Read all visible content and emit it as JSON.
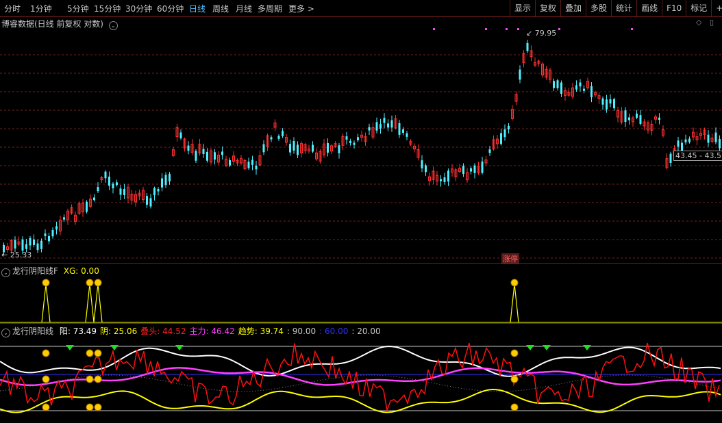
{
  "toolbar": {
    "periods": [
      "分时",
      "1分钟",
      "5分钟",
      "15分钟",
      "30分钟",
      "60分钟",
      "日线",
      "周线",
      "月线",
      "多周期",
      "更多 >"
    ],
    "active_period": "日线",
    "right_buttons": [
      "显示",
      "复权",
      "叠加",
      "多股",
      "统计",
      "画线",
      "F10",
      "标记",
      "+自选"
    ]
  },
  "main_chart": {
    "title": "博睿数据(日线 前复权 对数)",
    "high_label": "79.95",
    "low_label": "25.33",
    "last_price_label": "43.45 - 43.5",
    "event_badge": "涨停"
  },
  "indicator1": {
    "title": "龙行阴阳线F",
    "xg_label": "XG: 0.00"
  },
  "indicator2": {
    "title": "龙行阴阳线",
    "values": [
      {
        "name": "阳",
        "value": "73.49",
        "color": "#ffffff"
      },
      {
        "name": "阴",
        "value": "25.06",
        "color": "#ffff00"
      },
      {
        "name": "叠头",
        "value": "44.52",
        "color": "#ff2020"
      },
      {
        "name": "主力",
        "value": "46.42",
        "color": "#ff40ff"
      },
      {
        "name": "趋势",
        "value": "39.74",
        "color": "#ffff00"
      },
      {
        "name": "",
        "value": "90.00",
        "color": "#c8c8c8"
      },
      {
        "name": "",
        "value": "60.00",
        "color": "#3030ff"
      },
      {
        "name": "",
        "value": "20.00",
        "color": "#c8c8c8"
      }
    ]
  },
  "colors": {
    "up": "#ff3030",
    "down": "#4ef0ff",
    "grid": "#7a1f1f",
    "white_line": "#ffffff",
    "magenta_line": "#ff40ff",
    "yellow_line": "#ffff00",
    "red_line": "#ff1010"
  }
}
